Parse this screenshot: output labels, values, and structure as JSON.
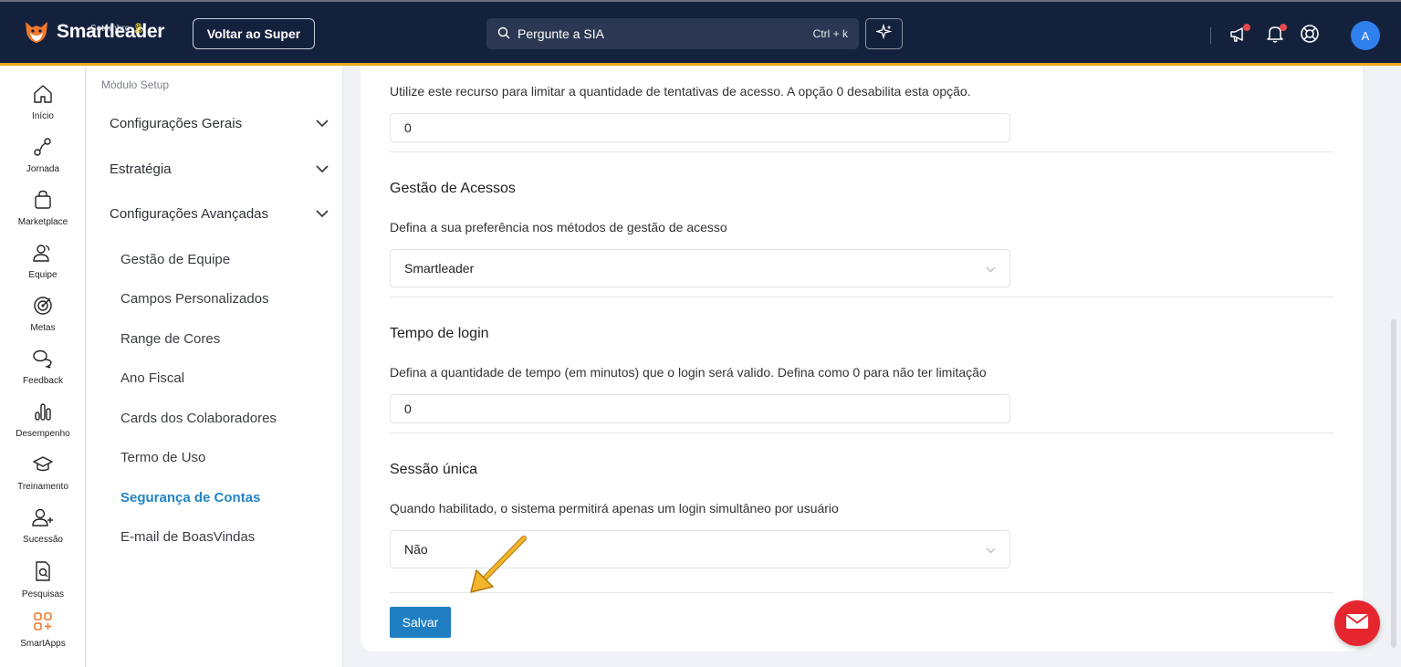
{
  "header": {
    "brand": "Smartleader",
    "brand_sub": "Setembro",
    "back_button": "Voltar ao Super",
    "search_placeholder": "Pergunte a SIA",
    "search_shortcut": "Ctrl + k",
    "avatar_initial": "A",
    "icons": [
      "megaphone-icon",
      "bell-icon",
      "help-lifebuoy-icon",
      "sparkle-ai-icon",
      "search-icon"
    ]
  },
  "nav": {
    "items": [
      {
        "label": "Início",
        "icon": "home-icon"
      },
      {
        "label": "Jornada",
        "icon": "route-icon"
      },
      {
        "label": "Marketplace",
        "icon": "shopping-bag-icon"
      },
      {
        "label": "Equipe",
        "icon": "team-icon"
      },
      {
        "label": "Metas",
        "icon": "target-icon"
      },
      {
        "label": "Feedback",
        "icon": "chat-bubbles-icon"
      },
      {
        "label": "Desempenho",
        "icon": "bar-chart-icon"
      },
      {
        "label": "Treinamento",
        "icon": "graduation-cap-icon"
      },
      {
        "label": "Sucessão",
        "icon": "user-plus-icon"
      },
      {
        "label": "Pesquisas",
        "icon": "document-search-icon"
      },
      {
        "label": "SmartApps",
        "icon": "apps-grid-icon"
      }
    ]
  },
  "submenu": {
    "heading": "Módulo Setup",
    "groups": [
      "Configurações Gerais",
      "Estratégia",
      "Configurações Avançadas"
    ],
    "items": [
      "Gestão de Equipe",
      "Campos Personalizados",
      "Range de Cores",
      "Ano Fiscal",
      "Cards dos Colaboradores",
      "Termo de Uso",
      "Segurança de Contas",
      "E-mail de BoasVindas"
    ],
    "active_item": "Segurança de Contas"
  },
  "form": {
    "attempts": {
      "description": "Utilize este recurso para limitar a quantidade de tentativas de acesso. A opção 0 desabilita esta opção.",
      "value": "0"
    },
    "access_mgmt": {
      "title": "Gestão de Acessos",
      "description": "Defina a sua preferência nos métodos de gestão de acesso",
      "value": "Smartleader"
    },
    "login_time": {
      "title": "Tempo de login",
      "description": "Defina a quantidade de tempo (em minutos) que o login será valido. Defina como 0 para não ter limitação",
      "value": "0"
    },
    "single_session": {
      "title": "Sessão única",
      "description": "Quando habilitado, o sistema permitirá apenas um login simultâneo por usuário",
      "value": "Não"
    },
    "save_label": "Salvar"
  },
  "colors": {
    "topbar": "#14213d",
    "accent_border": "#f0a81c",
    "primary": "#1f7ec2",
    "active_link": "#2384c6",
    "chat_fab": "#e6262e"
  }
}
